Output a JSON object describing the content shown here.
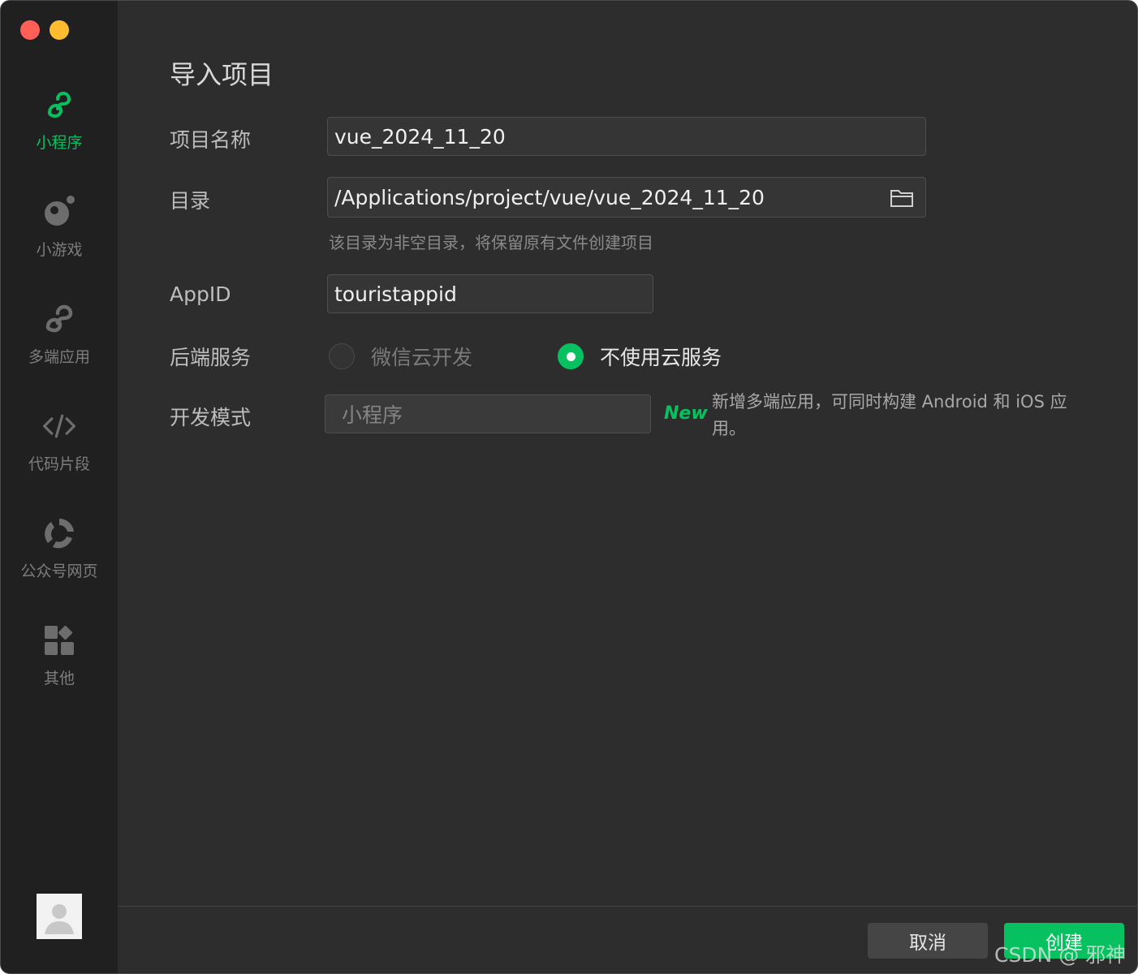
{
  "sidebar": {
    "items": [
      {
        "label": "小程序",
        "icon": "miniprogram-icon",
        "active": true
      },
      {
        "label": "小游戏",
        "icon": "minigame-icon",
        "active": false
      },
      {
        "label": "多端应用",
        "icon": "multiplatform-icon",
        "active": false
      },
      {
        "label": "代码片段",
        "icon": "code-icon",
        "active": false
      },
      {
        "label": "公众号网页",
        "icon": "official-account-icon",
        "active": false
      },
      {
        "label": "其他",
        "icon": "apps-grid-icon",
        "active": false
      }
    ],
    "avatar_icon": "user-avatar-icon"
  },
  "form": {
    "title": "导入项目",
    "project_name": {
      "label": "项目名称",
      "value": "vue_2024_11_20"
    },
    "directory": {
      "label": "目录",
      "value": "/Applications/project/vue/vue_2024_11_20",
      "icon": "folder-icon",
      "hint": "该目录为非空目录，将保留原有文件创建项目"
    },
    "appid": {
      "label": "AppID",
      "value": "touristappid"
    },
    "backend": {
      "label": "后端服务",
      "options": [
        {
          "label": "微信云开发",
          "selected": false
        },
        {
          "label": "不使用云服务",
          "selected": true
        }
      ]
    },
    "dev_mode": {
      "label": "开发模式",
      "value": "小程序",
      "new_tag": "New",
      "new_desc": "新增多端应用，可同时构建 Android 和 iOS 应用。"
    }
  },
  "footer": {
    "cancel_label": "取消",
    "create_label": "创建"
  },
  "watermark": "CSDN @ 邪神",
  "colors": {
    "accent": "#07c160",
    "background": "#2d2d2d",
    "sidebar": "#202020"
  }
}
